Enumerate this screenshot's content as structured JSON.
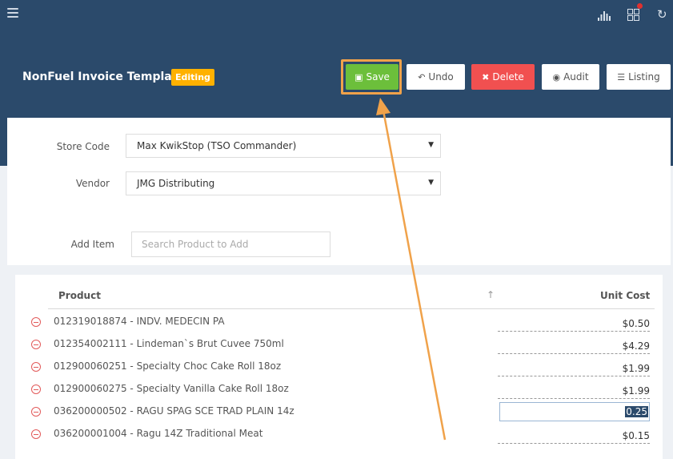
{
  "header": {
    "title": "NonFuel Invoice Template",
    "badge": "Editing",
    "icons": [
      "menu-icon",
      "chart-icon",
      "grid-icon",
      "refresh-icon"
    ]
  },
  "toolbar": {
    "save": "Save",
    "undo": "Undo",
    "delete": "Delete",
    "audit": "Audit",
    "listing": "Listing"
  },
  "form": {
    "store_code_label": "Store Code",
    "store_code_value": "Max KwikStop (TSO Commander)",
    "vendor_label": "Vendor",
    "vendor_value": "JMG Distributing",
    "add_item_label": "Add Item",
    "add_item_placeholder": "Search Product to Add"
  },
  "table": {
    "columns": [
      "Product",
      "Unit Cost"
    ],
    "sort_indicator": "↑",
    "rows": [
      {
        "product": "012319018874 - INDV. MEDECIN PA",
        "cost": "$0.50"
      },
      {
        "product": "012354002111 - Lindeman`s Brut Cuvee 750ml",
        "cost": "$4.29"
      },
      {
        "product": "012900060251 - Specialty Choc Cake Roll 18oz",
        "cost": "$1.99"
      },
      {
        "product": "012900060275 - Specialty Vanilla Cake Roll 18oz",
        "cost": "$1.99"
      },
      {
        "product": "036200000502 - RAGU SPAG SCE TRAD PLAIN 14z",
        "cost": "0.25"
      },
      {
        "product": "036200001004 - Ragu 14Z Traditional Meat",
        "cost": "$0.15"
      }
    ]
  },
  "colors": {
    "header_bg": "#2b4a6b",
    "save": "#6cbf3b",
    "delete": "#f15050",
    "badge": "#ffb100",
    "annotation": "#f0a24a"
  }
}
